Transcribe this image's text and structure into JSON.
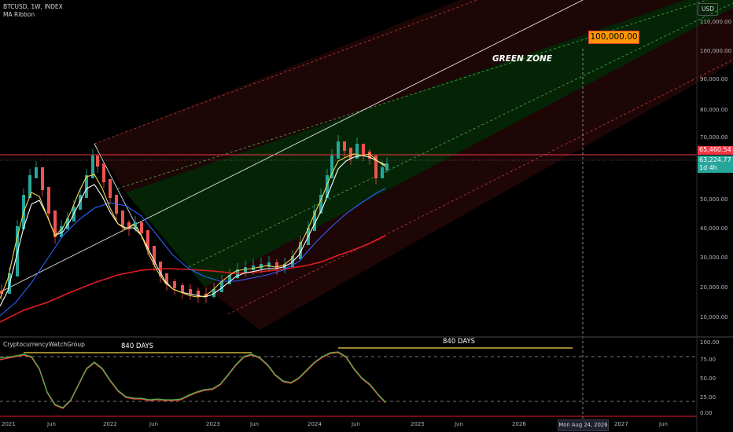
{
  "header": {
    "symbol": "BTCUSD, 1W, INDEX",
    "indicator": "MA Ribbon",
    "oscillator": "CryptocurrencyWatchGroup"
  },
  "currency_button": "USD",
  "price_axis": [
    "110,000.00",
    "100,000.00",
    "90,000.00",
    "80,000.00",
    "70,000.00",
    "50,000.00",
    "40,000.00",
    "30,000.00",
    "20,000.00",
    "10,000.00"
  ],
  "osc_axis": [
    "100.00",
    "75.00",
    "50.00",
    "25.00",
    "0.00"
  ],
  "time_axis": [
    "2021",
    "Jun",
    "2022",
    "Jun",
    "2023",
    "Jun",
    "2024",
    "Jun",
    "2025",
    "Jun",
    "2026",
    "2027",
    "Jun"
  ],
  "badges": {
    "line_price": "65,460.54",
    "last_price": "63,224.77",
    "countdown": "1d 4h"
  },
  "annotations": {
    "green_zone": "GREEN ZONE",
    "target": "100,000.00",
    "days_left": "840 DAYS",
    "days_right": "840 DAYS",
    "crosshair_date": "Mon Aug 24, 2026"
  },
  "colors": {
    "background": "#000000",
    "red_line": "#f23645",
    "last_price_badge": "#26a69a",
    "ma_yellow": "#f5d547",
    "ma_white": "#ffffff",
    "ma_blue": "#2962ff",
    "ma_red": "#e31b23",
    "callout": "#ff9800",
    "osc_green": "#4caf50",
    "osc_red": "#f44336"
  }
}
